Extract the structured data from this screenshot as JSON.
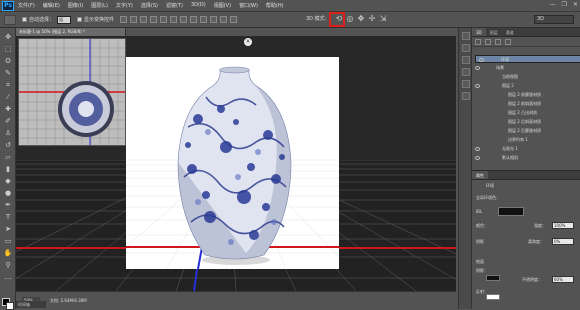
{
  "app": {
    "logo": "Ps"
  },
  "menu": [
    "文件(F)",
    "编辑(E)",
    "图像(I)",
    "图层(L)",
    "文字(Y)",
    "选择(S)",
    "滤镜(T)",
    "3D(D)",
    "视图(V)",
    "窗口(W)",
    "帮助(H)"
  ],
  "window_controls": [
    "—",
    "❐",
    "✕"
  ],
  "options": {
    "auto_select_label": "自动选择：",
    "auto_select_value": "组",
    "transform_label": "显示变换控件",
    "mode_label": "3D 模式："
  },
  "workspace": "3D",
  "document": {
    "tab_title": "未标题-1 @ 50% (图层 2, RGB/8) *",
    "zoom": "50%",
    "doc_info": "文档: 2.64M/6.38M",
    "timeline_label": "时间轴"
  },
  "panel3d": {
    "tabs": [
      "3D",
      "图层",
      "通道"
    ],
    "rows": [
      {
        "label": "环境",
        "indent": 0,
        "selected": true
      },
      {
        "label": "场景",
        "indent": 0,
        "selected": false
      },
      {
        "label": "当前视图",
        "indent": 1,
        "selected": false
      },
      {
        "label": "图层 2",
        "indent": 1,
        "selected": false
      },
      {
        "label": "图层 2 前膨胀材质",
        "indent": 2,
        "selected": false
      },
      {
        "label": "图层 2 前斜面材质",
        "indent": 2,
        "selected": false
      },
      {
        "label": "图层 2 凸出材质",
        "indent": 2,
        "selected": false
      },
      {
        "label": "图层 2 后斜面材质",
        "indent": 2,
        "selected": false
      },
      {
        "label": "图层 2 后膨胀材质",
        "indent": 2,
        "selected": false
      },
      {
        "label": "边界约束 1",
        "indent": 2,
        "selected": false
      },
      {
        "label": "无限光 1",
        "indent": 1,
        "selected": false
      },
      {
        "label": "默认相机",
        "indent": 1,
        "selected": false
      }
    ]
  },
  "properties": {
    "title": "属性",
    "tab": "环境",
    "global_env_label": "全局环境色：",
    "ibl_label": "IBL",
    "color_label": "颜色：",
    "intensity_label": "强度：",
    "intensity_value": "100%",
    "shadow_label": "阴影",
    "softness_label": "柔和度：",
    "softness_value": "0%",
    "ground_label": "地面",
    "ground_shadow_label": "阴影：",
    "opacity_label": "不透明度：",
    "opacity_value": "60%",
    "reflection_label": "反射："
  }
}
